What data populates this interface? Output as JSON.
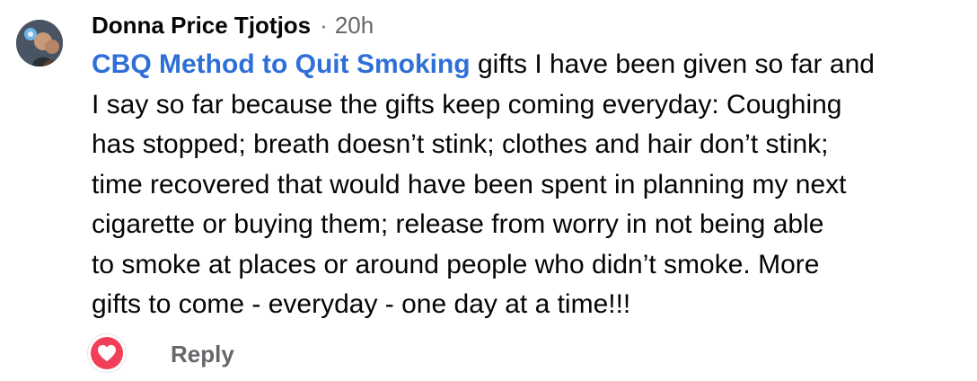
{
  "comment": {
    "author": "Donna Price Tjotjos",
    "separator": "·",
    "timestamp": "20h",
    "mention": "CBQ Method to Quit Smoking",
    "lines": [
      " gifts I have been given so far and",
      "I say so far because the gifts keep coming everyday: Coughing",
      "has stopped; breath doesn’t stink; clothes and hair don’t stink;",
      "time recovered that would have been spent in planning my next",
      "cigarette or buying them; release from worry in not being able",
      "to smoke at places or around people who didn’t smoke. More",
      "gifts to come - everyday - one day at a time!!!"
    ],
    "reaction_icon": "heart-icon",
    "reply_label": "Reply"
  },
  "colors": {
    "mention": "#2f6fd8",
    "secondary_text": "#65676b",
    "reaction_love": "#f33e58"
  }
}
